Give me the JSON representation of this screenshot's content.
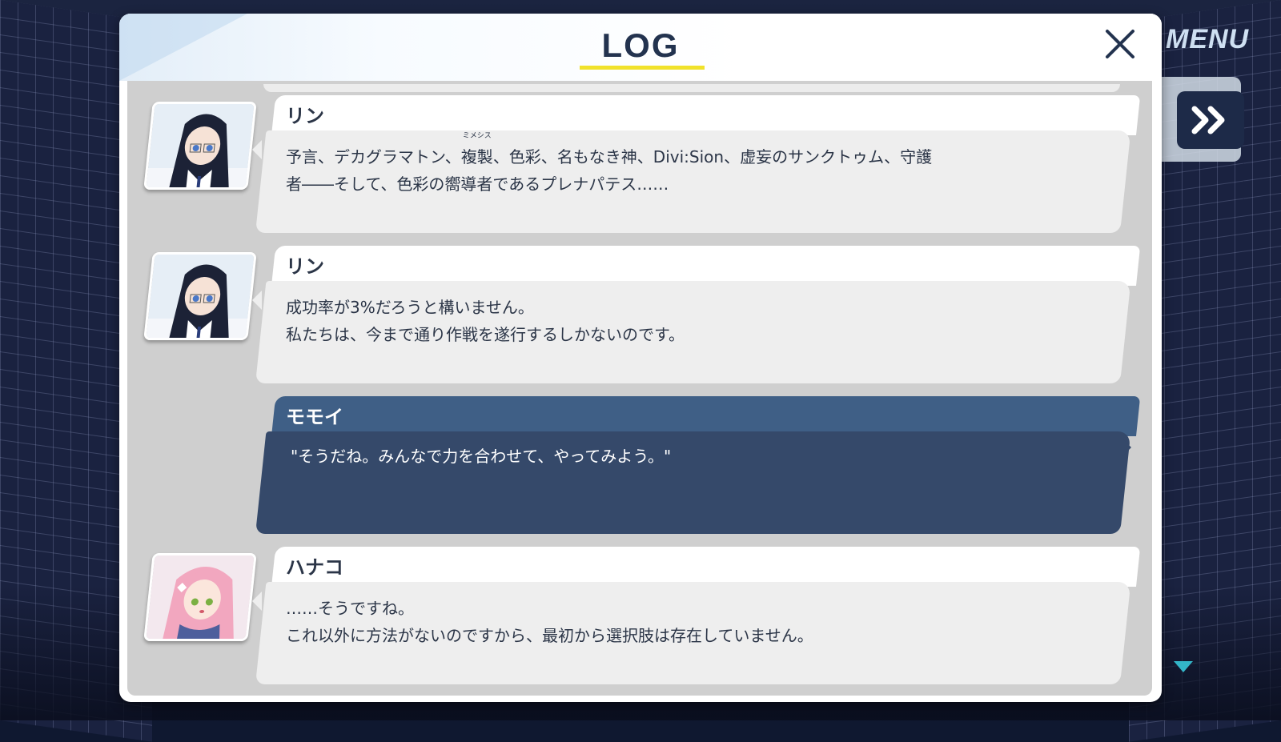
{
  "hud": {
    "menu_label": "MENU"
  },
  "log": {
    "title": "LOG",
    "entries": [
      {
        "speaker": "リン",
        "text_before": "予言、デカグラマトン、",
        "ruby_base": "複製",
        "ruby_reading": "ミメシス",
        "text_after": "、色彩、名もなき神、Divi:Sion、虚妄のサンクトゥム、守護\n者――そして、色彩の嚮導者であるプレナパテス……",
        "avatar": "rin-portrait"
      },
      {
        "speaker": "リン",
        "text": "成功率が3%だろうと構いません。\n私たちは、今まで通り作戦を遂行するしかないのです。",
        "avatar": "rin-portrait"
      },
      {
        "speaker": "モモイ",
        "text": "\"そうだね。みんなで力を合わせて、やってみよう。\"",
        "is_player": true
      },
      {
        "speaker": "ハナコ",
        "text": "……そうですね。\nこれ以外に方法がないのですから、最初から選択肢は存在していません。",
        "avatar": "hanako-portrait"
      }
    ]
  },
  "colors": {
    "title_underline": "#f1e22b",
    "player_name_bg": "#3f5f86",
    "player_body_bg": "#35496a",
    "npc_bubble": "#eeeeee",
    "text_dark": "#2b3547"
  }
}
